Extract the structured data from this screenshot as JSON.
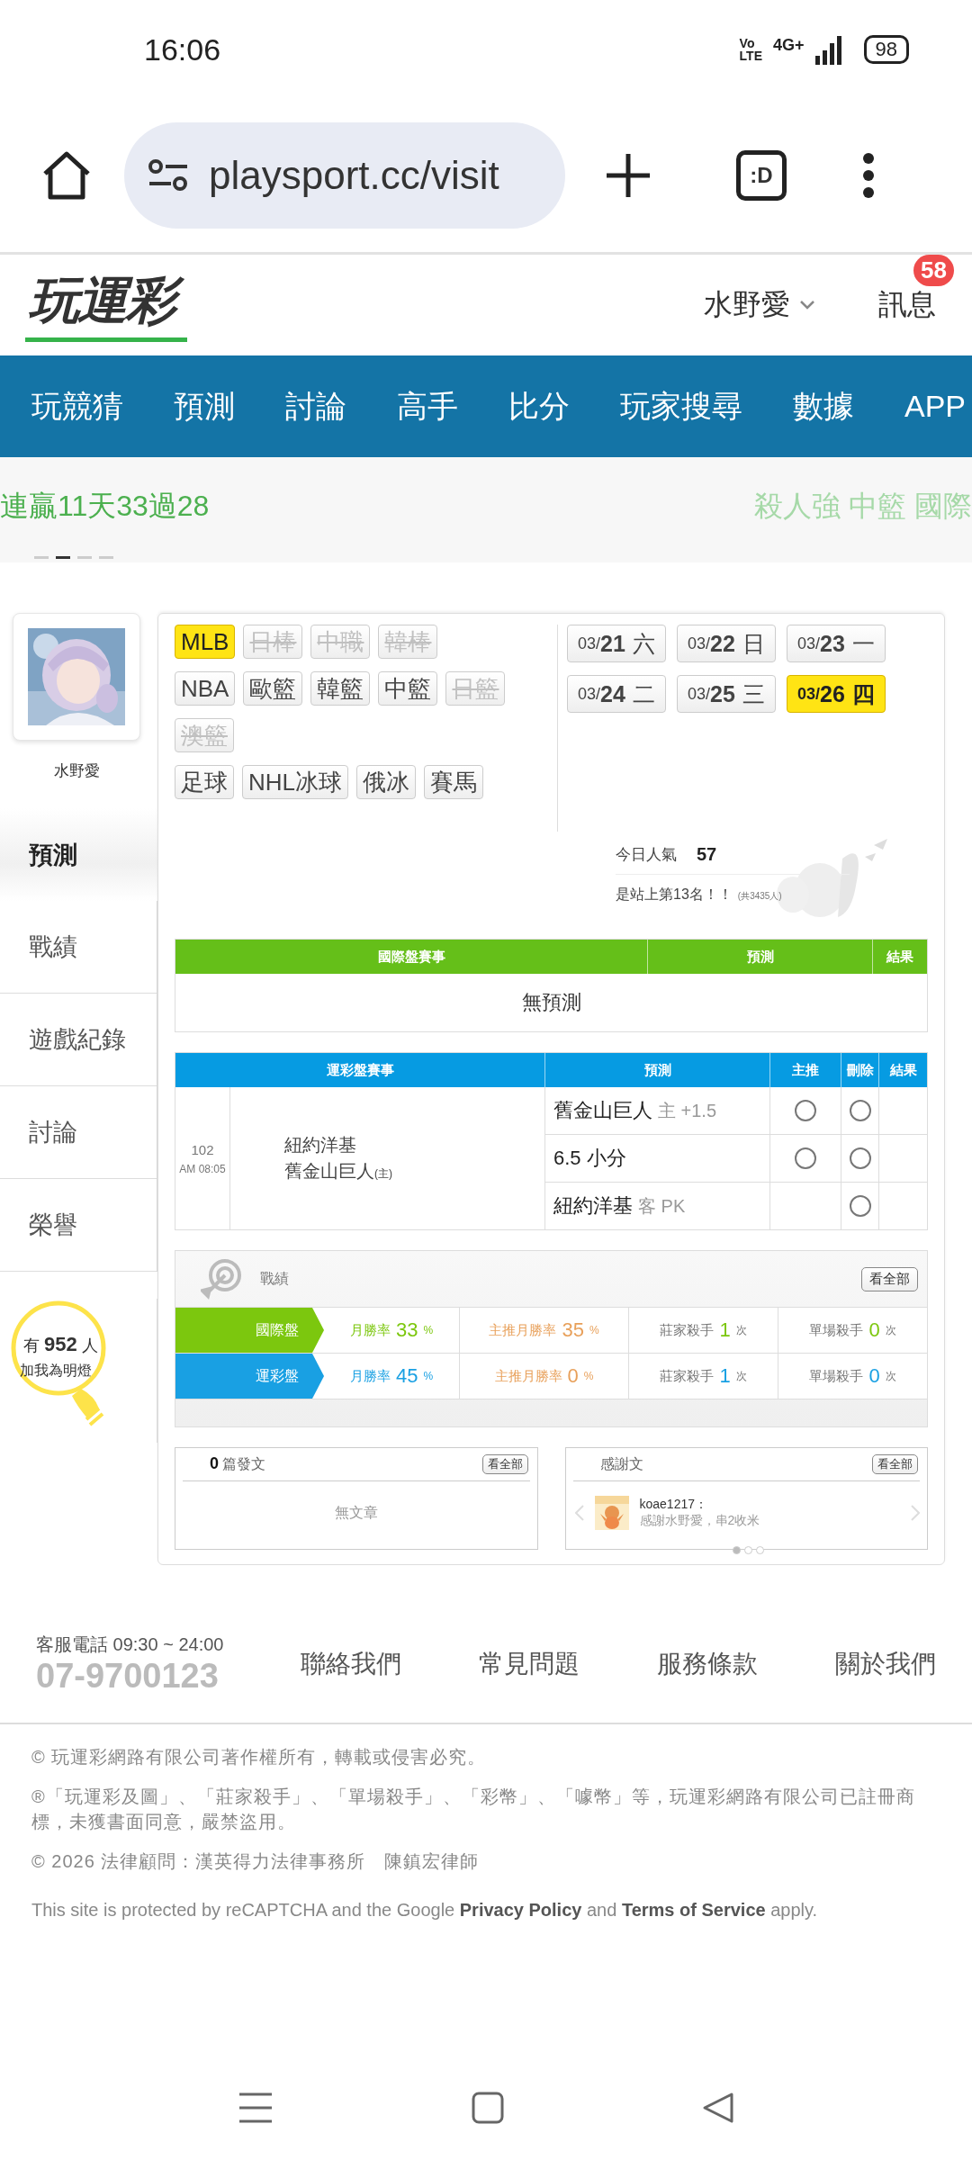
{
  "status_bar": {
    "time": "16:06",
    "volte": [
      "Vo",
      "LTE"
    ],
    "network": "4G+",
    "battery": "98"
  },
  "browser": {
    "url": "playsport.cc/visit",
    "tab_label": ":D"
  },
  "header": {
    "logo": "玩運彩",
    "user": "水野愛",
    "messages": "訊息",
    "badge": "58"
  },
  "nav": {
    "items": [
      "玩競猜",
      "預測",
      "討論",
      "高手",
      "比分",
      "玩家搜尋",
      "數據",
      "APP"
    ]
  },
  "ticker": {
    "left": "連贏11天33過28",
    "right": "殺人強 中籃 國際",
    "dots": [
      {
        "selected": false
      },
      {
        "selected": true
      },
      {
        "selected": false
      },
      {
        "selected": false
      }
    ]
  },
  "sidebar": {
    "name": "水野愛",
    "items": [
      {
        "label": "預測",
        "selected": true
      },
      {
        "label": "戰績",
        "selected": false
      },
      {
        "label": "遊戲紀錄",
        "selected": false
      },
      {
        "label": "討論",
        "selected": false
      },
      {
        "label": "榮譽",
        "selected": false
      }
    ],
    "fans": {
      "prefix": "有",
      "count": "952",
      "suffix": "人",
      "caption": "加我為明燈"
    }
  },
  "leagues": [
    [
      {
        "label": "MLB",
        "selected": true,
        "disabled": false
      },
      {
        "label": "日棒",
        "selected": false,
        "disabled": true
      },
      {
        "label": "中職",
        "selected": false,
        "disabled": true
      },
      {
        "label": "韓棒",
        "selected": false,
        "disabled": true
      }
    ],
    [
      {
        "label": "NBA",
        "selected": false,
        "disabled": false
      },
      {
        "label": "歐籃",
        "selected": false,
        "disabled": false
      },
      {
        "label": "韓籃",
        "selected": false,
        "disabled": false
      },
      {
        "label": "中籃",
        "selected": false,
        "disabled": false
      },
      {
        "label": "日籃",
        "selected": false,
        "disabled": true
      }
    ],
    [
      {
        "label": "澳籃",
        "selected": false,
        "disabled": true
      }
    ],
    [
      {
        "label": "足球",
        "selected": false,
        "disabled": false
      },
      {
        "label": "NHL冰球",
        "selected": false,
        "disabled": false
      },
      {
        "label": "俄冰",
        "selected": false,
        "disabled": false
      },
      {
        "label": "賽馬",
        "selected": false,
        "disabled": false
      }
    ]
  ],
  "dates": [
    {
      "month": "03/",
      "day": "21",
      "weekday": "六",
      "selected": false
    },
    {
      "month": "03/",
      "day": "22",
      "weekday": "日",
      "selected": false
    },
    {
      "month": "03/",
      "day": "23",
      "weekday": "一",
      "selected": false
    },
    {
      "month": "03/",
      "day": "24",
      "weekday": "二",
      "selected": false
    },
    {
      "month": "03/",
      "day": "25",
      "weekday": "三",
      "selected": false
    },
    {
      "month": "03/",
      "day": "26",
      "weekday": "四",
      "selected": true
    }
  ],
  "popularity": {
    "label": "今日人氣",
    "value": "57",
    "rank": "是站上第13名！！",
    "total": "(共3435人)"
  },
  "intl_table": {
    "columns": [
      "國際盤賽事",
      "預測",
      "結果"
    ],
    "empty": "無預測"
  },
  "sports_table": {
    "columns": [
      "運彩盤賽事",
      "預測",
      "主推",
      "刪除",
      "結果"
    ],
    "game": {
      "number": "102",
      "time": "AM 08:05",
      "away": "紐約洋基",
      "home": "舊金山巨人",
      "home_mark": "(主)"
    },
    "picks": [
      {
        "pick": "舊金山巨人",
        "detail": "主 +1.5",
        "options": [
          {
            "kind": "featured",
            "selected": false
          },
          {
            "kind": "delete",
            "selected": false
          }
        ]
      },
      {
        "pick": "6.5 小分",
        "options": [
          {
            "kind": "featured",
            "selected": false
          },
          {
            "kind": "delete",
            "selected": false
          }
        ]
      },
      {
        "pick": "紐約洋基",
        "detail": "客 PK",
        "options": [
          {
            "kind": "delete",
            "selected": false
          }
        ]
      }
    ]
  },
  "stats": {
    "title": "戰績",
    "view_all": "看全部",
    "rows": [
      {
        "label": "國際盤",
        "color": "#7cc70e",
        "cells": [
          {
            "kind": "main",
            "label": "月勝率",
            "value": "33",
            "unit": "%"
          },
          {
            "kind": "featured",
            "label": "主推月勝率",
            "value": "35",
            "unit": "%"
          },
          {
            "kind": "count",
            "label": "莊家殺手",
            "value": "1",
            "unit": "次"
          },
          {
            "kind": "count",
            "label": "單場殺手",
            "value": "0",
            "unit": "次"
          }
        ]
      },
      {
        "label": "運彩盤",
        "color": "#19a0e3",
        "cells": [
          {
            "kind": "main",
            "label": "月勝率",
            "value": "45",
            "unit": "%"
          },
          {
            "kind": "featured",
            "label": "主推月勝率",
            "value": "0",
            "unit": "%"
          },
          {
            "kind": "count",
            "label": "莊家殺手",
            "value": "1",
            "unit": "次"
          },
          {
            "kind": "count",
            "label": "單場殺手",
            "value": "0",
            "unit": "次"
          }
        ]
      }
    ]
  },
  "posts": {
    "count": "0",
    "label": "篇發文",
    "view_all": "看全部",
    "empty": "無文章"
  },
  "thanks": {
    "title": "感謝文",
    "view_all": "看全部",
    "user": "koae1217：",
    "text": "感謝水野愛，串2收米",
    "dots": [
      {
        "selected": true
      },
      {
        "selected": false
      },
      {
        "selected": false
      }
    ]
  },
  "footer": {
    "hotline": "客服電話 09:30 ~ 24:00",
    "phone": "07-9700123",
    "links": [
      "聯絡我們",
      "常見問題",
      "服務條款",
      "關於我們"
    ],
    "legal": [
      "© 玩運彩網路有限公司著作權所有，轉載或侵害必究。",
      "®「玩運彩及圖」、「莊家殺手」、「單場殺手」、「彩幣」、「噱幣」等，玩運彩網路有限公司已註冊商標，未獲書面同意，嚴禁盜用。",
      "© 2026 法律顧問：漢英得力法律事務所　陳鎮宏律師"
    ],
    "recaptcha": "This site is protected by reCAPTCHA and the Google **Privacy Policy** and **Terms of Service** apply."
  }
}
